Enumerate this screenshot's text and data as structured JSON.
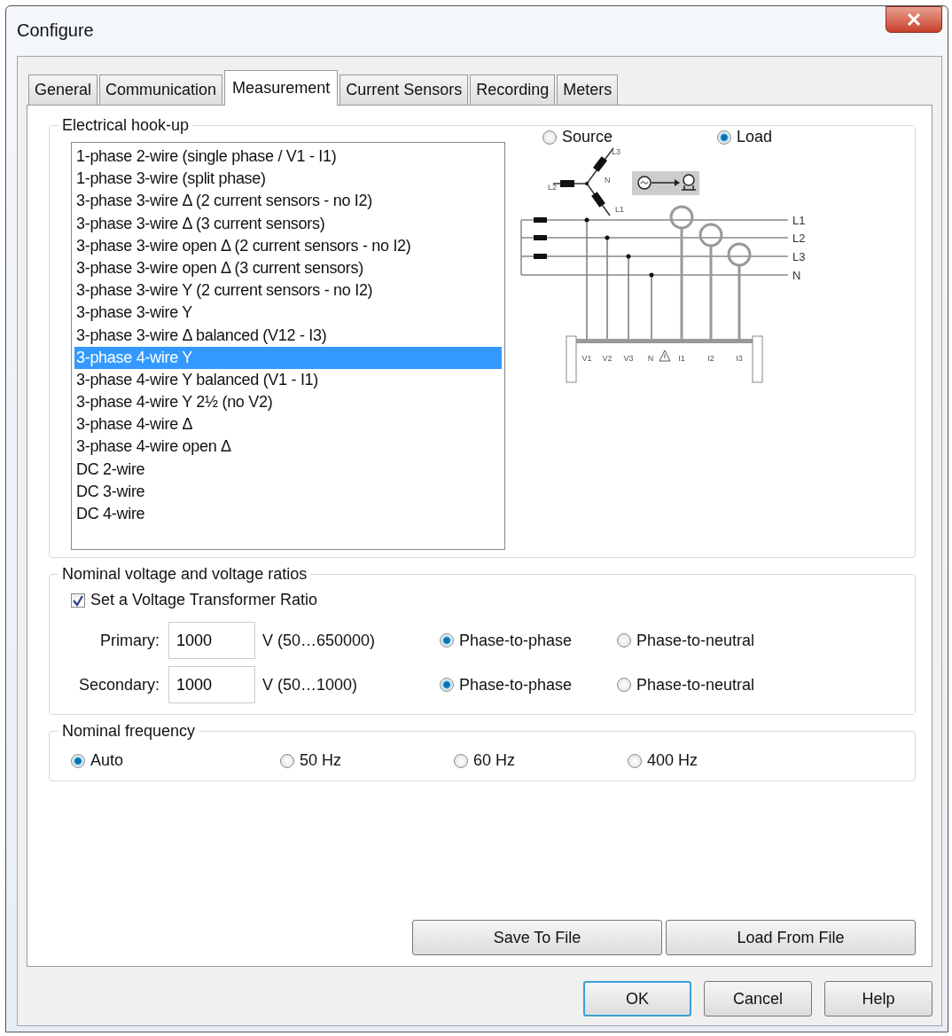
{
  "window": {
    "title": "Configure"
  },
  "tabs": [
    {
      "label": "General",
      "selected": false
    },
    {
      "label": "Communication",
      "selected": false
    },
    {
      "label": "Measurement",
      "selected": true
    },
    {
      "label": "Current Sensors",
      "selected": false
    },
    {
      "label": "Recording",
      "selected": false
    },
    {
      "label": "Meters",
      "selected": false
    }
  ],
  "hookup": {
    "title": "Electrical hook-up",
    "items": [
      {
        "label": "1-phase 2-wire (single phase / V1 - I1)",
        "selected": false
      },
      {
        "label": "1-phase 3-wire (split phase)",
        "selected": false
      },
      {
        "label": "3-phase 3-wire Δ (2 current sensors - no I2)",
        "selected": false
      },
      {
        "label": "3-phase 3-wire Δ (3 current sensors)",
        "selected": false
      },
      {
        "label": "3-phase 3-wire open Δ (2 current sensors - no I2)",
        "selected": false
      },
      {
        "label": "3-phase 3-wire open Δ (3 current sensors)",
        "selected": false
      },
      {
        "label": "3-phase 3-wire Y (2 current sensors - no I2)",
        "selected": false
      },
      {
        "label": "3-phase 3-wire Y",
        "selected": false
      },
      {
        "label": "3-phase 3-wire Δ balanced (V12 - I3)",
        "selected": false
      },
      {
        "label": "3-phase 4-wire Y",
        "selected": true
      },
      {
        "label": "3-phase 4-wire Y balanced (V1 - I1)",
        "selected": false
      },
      {
        "label": "3-phase 4-wire Y 2½ (no V2)",
        "selected": false
      },
      {
        "label": "3-phase 4-wire Δ",
        "selected": false
      },
      {
        "label": "3-phase 4-wire open Δ",
        "selected": false
      },
      {
        "label": "DC 2-wire",
        "selected": false
      },
      {
        "label": "DC 3-wire",
        "selected": false
      },
      {
        "label": "DC 4-wire",
        "selected": false
      }
    ],
    "side": [
      {
        "label": "Source",
        "selected": false
      },
      {
        "label": "Load",
        "selected": true
      }
    ],
    "diagram": {
      "star_labels": [
        "L3",
        "N",
        "L2",
        "L1"
      ],
      "line_labels": [
        "L1",
        "L2",
        "L3",
        "N"
      ],
      "terminal_labels": [
        "V1",
        "V2",
        "V3",
        "N",
        "I1",
        "I2",
        "I3"
      ]
    }
  },
  "voltage": {
    "title": "Nominal voltage and voltage ratios",
    "checkbox": {
      "label": "Set a Voltage Transformer Ratio",
      "checked": true
    },
    "rows": [
      {
        "label": "Primary:",
        "value": "1000",
        "range": "V (50…650000)",
        "options": [
          {
            "label": "Phase-to-phase",
            "selected": true
          },
          {
            "label": "Phase-to-neutral",
            "selected": false
          }
        ]
      },
      {
        "label": "Secondary:",
        "value": "1000",
        "range": "V (50…1000)",
        "options": [
          {
            "label": "Phase-to-phase",
            "selected": true
          },
          {
            "label": "Phase-to-neutral",
            "selected": false
          }
        ]
      }
    ]
  },
  "frequency": {
    "title": "Nominal frequency",
    "options": [
      {
        "label": "Auto",
        "selected": true
      },
      {
        "label": "50 Hz",
        "selected": false
      },
      {
        "label": "60 Hz",
        "selected": false
      },
      {
        "label": "400 Hz",
        "selected": false
      }
    ]
  },
  "file_buttons": [
    "Save To File",
    "Load From File"
  ],
  "dialog_buttons": [
    {
      "label": "OK",
      "default": true
    },
    {
      "label": "Cancel",
      "default": false
    },
    {
      "label": "Help",
      "default": false
    }
  ]
}
